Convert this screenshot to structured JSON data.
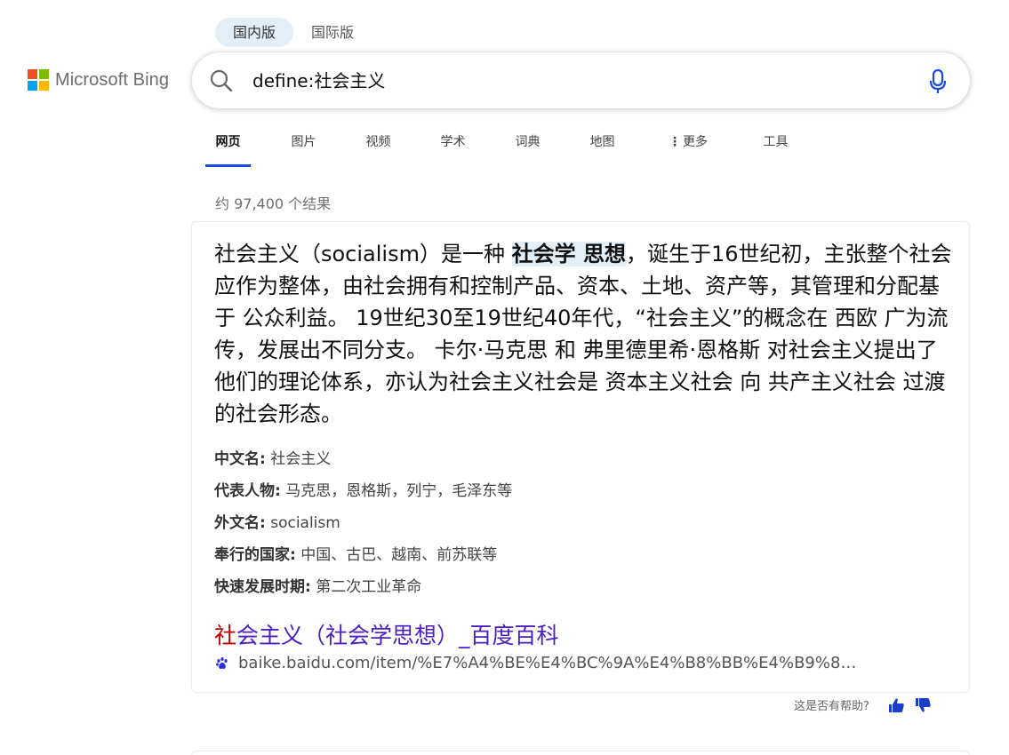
{
  "region_tabs": [
    {
      "label": "国内版",
      "active": true
    },
    {
      "label": "国际版",
      "active": false
    }
  ],
  "logo": {
    "text": "Microsoft Bing",
    "colors": [
      "#f25022",
      "#7fba00",
      "#00a4ef",
      "#ffb900"
    ]
  },
  "search": {
    "value": "define:社会主义",
    "icon": "search-icon",
    "mic_icon": "microphone-icon"
  },
  "nav": {
    "items": [
      {
        "label": "网页",
        "active": true
      },
      {
        "label": "图片"
      },
      {
        "label": "视频"
      },
      {
        "label": "学术"
      },
      {
        "label": "词典"
      },
      {
        "label": "地图"
      },
      {
        "label": "更多"
      },
      {
        "label": "工具"
      }
    ],
    "accent": "#174ae4"
  },
  "result_count": "约 97,400 个结果",
  "definition": {
    "part1": "社会主义（socialism）是一种 ",
    "highlight": "社会学 思想",
    "part2": "，诞生于16世纪初，主张整个社会应作为整体，由社会拥有和控制产品、资本、土地、资产等，其管理和分配基于 公众利益。 19世纪30至19世纪40年代，“社会主义”的概念在 西欧 广为流传，发展出不同分支。 卡尔·马克思 和 弗里德里希·恩格斯 对社会主义提出了他们的理论体系，亦认为社会主义社会是 资本主义社会 向 共产主义社会 过渡的社会形态。"
  },
  "facts": [
    {
      "key": "中文名:",
      "value": "社会主义"
    },
    {
      "key": "代表人物:",
      "value": "马克思，恩格斯，列宁，毛泽东等"
    },
    {
      "key": "外文名:",
      "value": "socialism"
    },
    {
      "key": "奉行的国家:",
      "value": "中国、古巴、越南、前苏联等"
    },
    {
      "key": "快速发展时期:",
      "value": "第二次工业革命"
    }
  ],
  "result": {
    "title_first": "社",
    "title_rest": "会主义（社会学思想）_百度百科",
    "url": "baike.baidu.com/item/%E7%A4%BE%E4%BC%9A%E4%B8%BB%E4%B9%8…",
    "site_icon": "baidu-paw-icon"
  },
  "feedback": {
    "label": "这是否有帮助?",
    "up_icon": "thumbs-up-icon",
    "down_icon": "thumbs-down-icon"
  }
}
